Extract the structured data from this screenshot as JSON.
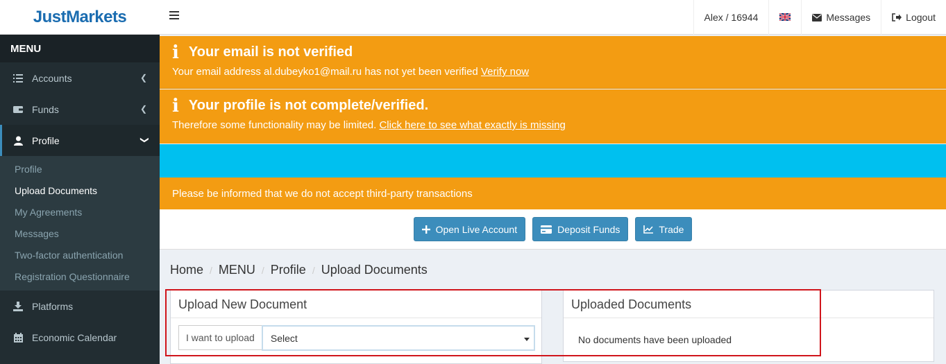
{
  "brand": {
    "logo": "JustMarkets"
  },
  "sidebar": {
    "menu_header": "MENU",
    "items": [
      {
        "label": "Accounts",
        "icon": "list-icon"
      },
      {
        "label": "Funds",
        "icon": "wallet-icon"
      },
      {
        "label": "Profile",
        "icon": "user-icon"
      }
    ],
    "profile_sub": [
      "Profile",
      "Upload Documents",
      "My Agreements",
      "Messages",
      "Two-factor authentication",
      "Registration Questionnaire"
    ],
    "bottom_items": [
      {
        "label": "Platforms",
        "icon": "download-icon"
      },
      {
        "label": "Economic Calendar",
        "icon": "calendar-icon"
      }
    ]
  },
  "topbar": {
    "user": "Alex / 16944",
    "flag": "uk-flag-icon",
    "messages": "Messages",
    "logout": "Logout"
  },
  "alerts": {
    "email": {
      "title": "Your email is not verified",
      "body": "Your email address al.dubeyko1@mail.ru has not yet been verified",
      "link": "Verify now"
    },
    "profile": {
      "title": "Your profile is not complete/verified.",
      "body": "Therefore some functionality may be limited.",
      "link": "Click here to see what exactly is missing"
    },
    "third_party": "Please be informed that we do not accept third-party transactions"
  },
  "actions": {
    "open_live": "Open Live Account",
    "deposit": "Deposit Funds",
    "trade": "Trade"
  },
  "breadcrumb": [
    "Home",
    "MENU",
    "Profile",
    "Upload Documents"
  ],
  "upload": {
    "title": "Upload New Document",
    "label": "I want to upload",
    "select_value": "Select"
  },
  "uploaded": {
    "title": "Uploaded Documents",
    "empty": "No documents have been uploaded"
  },
  "colors": {
    "warning": "#f39c12",
    "info": "#00c0ef",
    "primary": "#3c8dbc",
    "sidebar": "#222d32",
    "highlight": "#d0141b"
  }
}
